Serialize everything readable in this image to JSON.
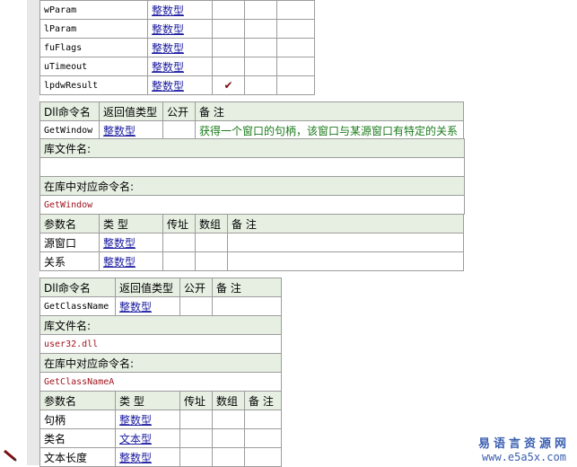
{
  "params_top": {
    "rows": [
      {
        "name": "wParam",
        "type": "整数型",
        "byref": "",
        "array": "",
        "note": ""
      },
      {
        "name": "lParam",
        "type": "整数型",
        "byref": "",
        "array": "",
        "note": ""
      },
      {
        "name": "fuFlags",
        "type": "整数型",
        "byref": "",
        "array": "",
        "note": ""
      },
      {
        "name": "uTimeout",
        "type": "整数型",
        "byref": "",
        "array": "",
        "note": ""
      },
      {
        "name": "lpdwResult",
        "type": "整数型",
        "byref": "✔",
        "array": "",
        "note": ""
      }
    ]
  },
  "dll_getwindow": {
    "h_cmd": "Dll命令名",
    "h_ret": "返回值类型",
    "h_public": "公开",
    "h_note": "备 注",
    "cmd": "GetWindow",
    "ret": "整数型",
    "public": "",
    "note": "获得一个窗口的句柄，该窗口与某源窗口有特定的关系",
    "lib_label": "库文件名:",
    "lib_value": "",
    "entry_label": "在库中对应命令名:",
    "entry_value": "GetWindow",
    "p_name": "参数名",
    "p_type": "类 型",
    "p_byref": "传址",
    "p_array": "数组",
    "p_note": "备 注",
    "params": [
      {
        "name": "源窗口",
        "type": "整数型"
      },
      {
        "name": "关系",
        "type": "整数型"
      }
    ]
  },
  "dll_getclassname": {
    "h_cmd": "Dll命令名",
    "h_ret": "返回值类型",
    "h_public": "公开",
    "h_note": "备 注",
    "cmd": "GetClassName",
    "ret": "整数型",
    "public": "",
    "note": "",
    "lib_label": "库文件名:",
    "lib_value": "user32.dll",
    "entry_label": "在库中对应命令名:",
    "entry_value": "GetClassNameA",
    "p_name": "参数名",
    "p_type": "类 型",
    "p_byref": "传址",
    "p_array": "数组",
    "p_note": "备 注",
    "params": [
      {
        "name": "句柄",
        "type": "整数型"
      },
      {
        "name": "类名",
        "type": "文本型"
      },
      {
        "name": "文本长度",
        "type": "整数型"
      }
    ]
  },
  "watermark": {
    "line1": "易语言资源网",
    "line2": "www.e5a5x.com"
  }
}
